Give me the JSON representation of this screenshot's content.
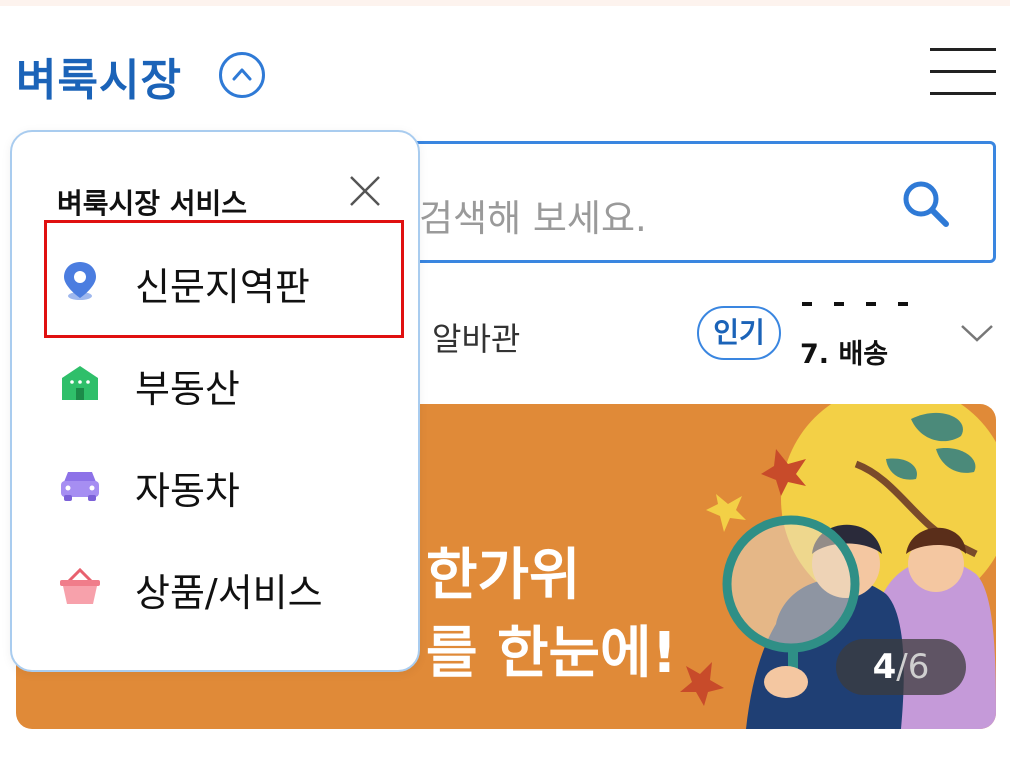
{
  "header": {
    "brand": "벼룩시장",
    "toggle_icon": "chevron-up-circle-icon",
    "menu_icon": "hamburger-menu-icon",
    "brand_color": "#1b63b8"
  },
  "search": {
    "placeholder_visible": "검색해 보세요.",
    "icon": "search-icon",
    "accent": "#3a86e0"
  },
  "keywords": {
    "partial_item": "알바관",
    "badge": "인기",
    "rank_item": "7. 배송",
    "expand_icon": "chevron-down-icon"
  },
  "banner": {
    "line1": "한가위",
    "line2": "를 한눈에!",
    "pager_current": "4",
    "pager_sep": "/",
    "pager_total": "6",
    "background": "#e08a38"
  },
  "dropdown": {
    "title": "벼룩시장 서비스",
    "close_icon": "close-icon",
    "items": [
      {
        "label": "신문지역판",
        "icon": "map-pin-icon",
        "color": "#4b7de0",
        "highlighted": true
      },
      {
        "label": "부동산",
        "icon": "house-icon",
        "color": "#2fbf6a",
        "highlighted": false
      },
      {
        "label": "자동차",
        "icon": "car-icon",
        "color": "#a68ef2",
        "highlighted": false
      },
      {
        "label": "상품/서비스",
        "icon": "basket-icon",
        "color": "#f07d8a",
        "highlighted": false
      }
    ]
  }
}
